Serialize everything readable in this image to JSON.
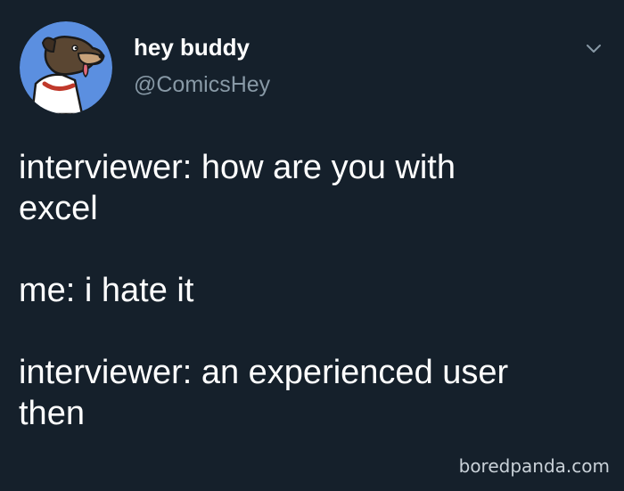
{
  "tweet": {
    "display_name": "hey buddy",
    "handle": "@ComicsHey",
    "menu_icon": "chevron-down-icon",
    "avatar_icon": "cartoon-dog-avatar",
    "paragraphs": [
      "interviewer: how are you with\nexcel",
      "me: i hate it",
      "interviewer: an experienced user\nthen"
    ]
  },
  "watermark": "boredpanda.com",
  "colors": {
    "background": "#15202b",
    "text": "#ffffff",
    "handle": "#8899a6",
    "avatar_bg": "#5b8fe0"
  }
}
